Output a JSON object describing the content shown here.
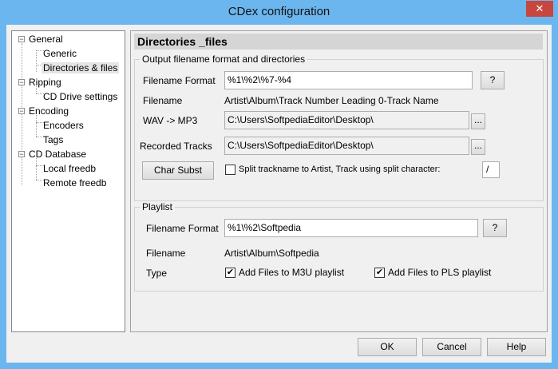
{
  "window": {
    "title": "CDex configuration",
    "close_glyph": "✕"
  },
  "tree": {
    "items": [
      {
        "label": "General",
        "expander": "−"
      },
      {
        "label": "Generic"
      },
      {
        "label": "Directories & files"
      },
      {
        "label": "Ripping",
        "expander": "−"
      },
      {
        "label": "CD Drive settings"
      },
      {
        "label": "Encoding",
        "expander": "−"
      },
      {
        "label": "Encoders"
      },
      {
        "label": "Tags"
      },
      {
        "label": "CD Database",
        "expander": "−"
      },
      {
        "label": "Local freedb"
      },
      {
        "label": "Remote freedb"
      }
    ]
  },
  "panel": {
    "title": "Directories _files",
    "output_group": {
      "legend": "Output filename format and directories",
      "filename_format_label": "Filename Format",
      "filename_format_value": "%1\\%2\\%7-%4",
      "help_label": "?",
      "filename_label": "Filename",
      "filename_value": "Artist\\Album\\Track Number Leading 0-Track Name",
      "wav_mp3_label": "WAV -> MP3",
      "wav_mp3_value": "C:\\Users\\SoftpediaEditor\\Desktop\\",
      "browse_label": "...",
      "recorded_label": "Recorded Tracks",
      "recorded_value": "C:\\Users\\SoftpediaEditor\\Desktop\\",
      "char_subst_label": "Char Subst",
      "split_label": "Split trackname to Artist, Track using split character:",
      "split_checked": false,
      "split_char": "/"
    },
    "playlist_group": {
      "legend": "Playlist",
      "filename_format_label": "Filename Format",
      "filename_format_value": "%1\\%2\\Softpedia",
      "help_label": "?",
      "filename_label": "Filename",
      "filename_value": "Artist\\Album\\Softpedia",
      "type_label": "Type",
      "m3u_label": "Add Files to M3U playlist",
      "m3u_checked": true,
      "pls_label": "Add Files to PLS playlist",
      "pls_checked": true,
      "check_glyph": "✔"
    }
  },
  "footer": {
    "ok": "OK",
    "cancel": "Cancel",
    "help": "Help"
  }
}
